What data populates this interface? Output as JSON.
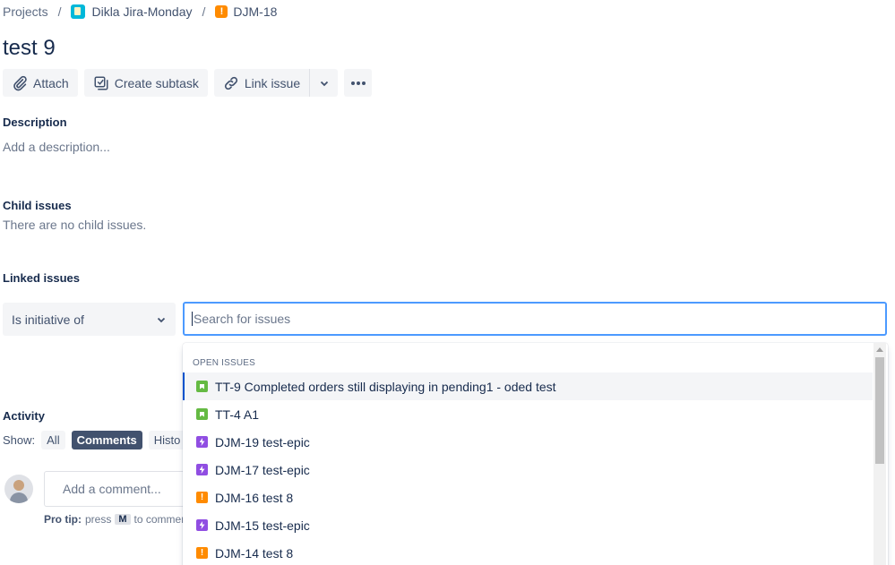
{
  "breadcrumb": {
    "projects": "Projects",
    "separator": "/",
    "project_name": "Dikla Jira-Monday",
    "issue_key": "DJM-18"
  },
  "issue": {
    "title": "test 9"
  },
  "toolbar": {
    "attach": "Attach",
    "create_subtask": "Create subtask",
    "link_issue": "Link issue"
  },
  "description": {
    "label": "Description",
    "placeholder": "Add a description..."
  },
  "child_issues": {
    "label": "Child issues",
    "empty": "There are no child issues."
  },
  "linked_issues": {
    "label": "Linked issues",
    "link_type": "Is initiative of",
    "search_placeholder": "Search for issues"
  },
  "dropdown": {
    "heading": "OPEN ISSUES",
    "items": [
      {
        "type": "story-icon",
        "text": "TT-9 Completed orders still displaying in pending1 - oded test"
      },
      {
        "type": "story-icon",
        "text": "TT-4 A1"
      },
      {
        "type": "epic-icon",
        "text": "DJM-19 test-epic"
      },
      {
        "type": "epic-icon",
        "text": "DJM-17 test-epic"
      },
      {
        "type": "bug-icon",
        "text": "DJM-16 test 8"
      },
      {
        "type": "epic-icon",
        "text": "DJM-15 test-epic"
      },
      {
        "type": "bug-icon",
        "text": "DJM-14 test 8"
      }
    ]
  },
  "activity": {
    "label": "Activity",
    "show": "Show:",
    "filters": {
      "all": "All",
      "comments": "Comments",
      "history": "Histo"
    },
    "comment_placeholder": "Add a comment...",
    "protip_label": "Pro tip:",
    "protip_press": "press",
    "protip_key": "M",
    "protip_rest": "to comment"
  },
  "colors": {
    "accent": "#0052cc",
    "focus_border": "#4c9aff",
    "story": "#65ba43",
    "epic": "#904ee2",
    "bug": "#ff8b00"
  }
}
